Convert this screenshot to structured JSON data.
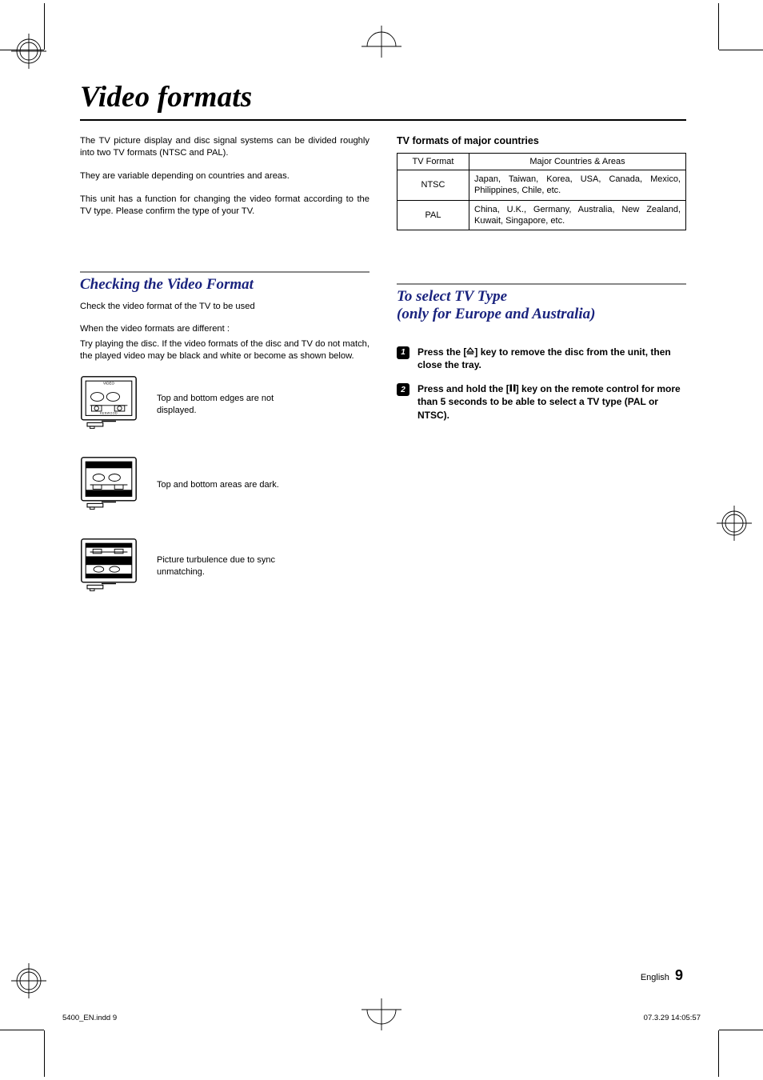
{
  "title": "Video formats",
  "intro": {
    "p1": "The TV picture display and disc signal systems can be divided roughly into two TV formats (NTSC and PAL).",
    "p2": "They are variable depending on countries and areas.",
    "p3": "This unit has a function for changing the video format according to the TV type. Please confirm the type of your TV."
  },
  "tableHeading": "TV formats of major countries",
  "table": {
    "h1": "TV Format",
    "h2": "Major Countries & Areas",
    "rows": [
      {
        "format": "NTSC",
        "areas": "Japan, Taiwan, Korea, USA, Canada, Mexico, Philippines, Chile, etc."
      },
      {
        "format": "PAL",
        "areas": "China, U.K., Germany, Australia, New Zealand, Kuwait, Singapore, etc."
      }
    ]
  },
  "checking": {
    "heading": "Checking the Video Format",
    "p1": "Check the video format of the TV to be used",
    "p2": "When the video formats are different :",
    "p3": "Try playing the disc. If the video formats of the disc and TV do not match, the played video may be black and white or become as shown below.",
    "ex1": "Top and bottom edges are not displayed.",
    "ex2": "Top and bottom areas are dark.",
    "ex3": "Picture turbulence due to sync unmatching."
  },
  "select": {
    "heading": "To select TV Type\n(only for Europe and Australia)",
    "step1a": "Press the [",
    "step1b": "] key to remove the disc from the unit, then close the tray.",
    "step2a": "Press and hold the [",
    "step2b": "] key on the remote control for more than 5 seconds to be able to select a TV type (PAL or NTSC)."
  },
  "footer": {
    "lang": "English",
    "page": "9"
  },
  "imprint": {
    "left": "5400_EN.indd   9",
    "right": "07.3.29   14:05:57"
  }
}
